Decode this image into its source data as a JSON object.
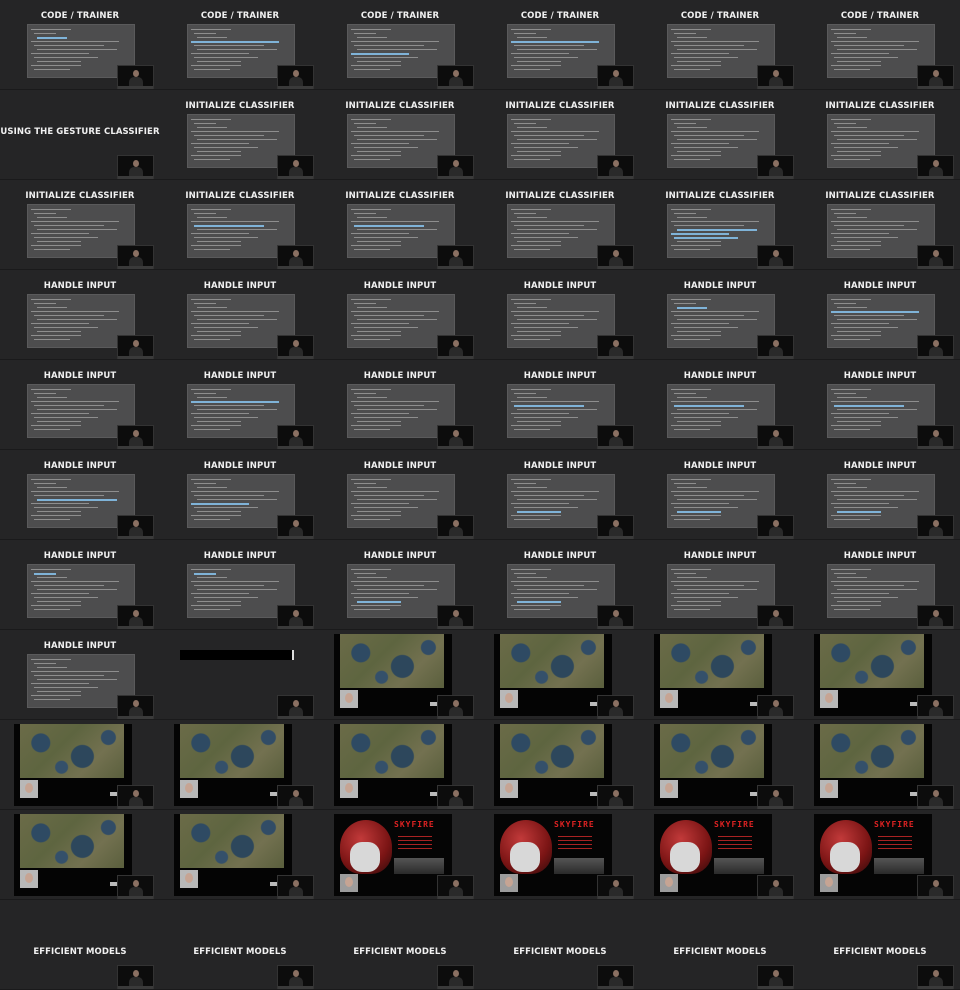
{
  "cells": [
    {
      "title": "CODE / TRAINER",
      "kind": "code",
      "hl": [
        2
      ]
    },
    {
      "title": "CODE / TRAINER",
      "kind": "code",
      "hl": [
        3
      ]
    },
    {
      "title": "CODE / TRAINER",
      "kind": "code",
      "hl": [
        6
      ]
    },
    {
      "title": "CODE / TRAINER",
      "kind": "code",
      "hl": [
        3
      ]
    },
    {
      "title": "CODE / TRAINER",
      "kind": "code",
      "hl": []
    },
    {
      "title": "CODE / TRAINER",
      "kind": "code",
      "hl": []
    },
    {
      "title": "USING THE GESTURE CLASSIFIER",
      "kind": "title-only",
      "hl": []
    },
    {
      "title": "INITIALIZE CLASSIFIER",
      "kind": "code",
      "hl": []
    },
    {
      "title": "INITIALIZE CLASSIFIER",
      "kind": "code",
      "hl": []
    },
    {
      "title": "INITIALIZE CLASSIFIER",
      "kind": "code",
      "hl": []
    },
    {
      "title": "INITIALIZE CLASSIFIER",
      "kind": "code",
      "hl": []
    },
    {
      "title": "INITIALIZE CLASSIFIER",
      "kind": "code",
      "hl": []
    },
    {
      "title": "INITIALIZE CLASSIFIER",
      "kind": "code",
      "hl": []
    },
    {
      "title": "INITIALIZE CLASSIFIER",
      "kind": "code",
      "hl": [
        4
      ]
    },
    {
      "title": "INITIALIZE CLASSIFIER",
      "kind": "code",
      "hl": [
        4
      ]
    },
    {
      "title": "INITIALIZE CLASSIFIER",
      "kind": "code",
      "hl": []
    },
    {
      "title": "INITIALIZE CLASSIFIER",
      "kind": "code",
      "hl": [
        5,
        6,
        7
      ]
    },
    {
      "title": "INITIALIZE CLASSIFIER",
      "kind": "code",
      "hl": []
    },
    {
      "title": "HANDLE INPUT",
      "kind": "code",
      "hl": []
    },
    {
      "title": "HANDLE INPUT",
      "kind": "code",
      "hl": []
    },
    {
      "title": "HANDLE INPUT",
      "kind": "code",
      "hl": []
    },
    {
      "title": "HANDLE INPUT",
      "kind": "code",
      "hl": []
    },
    {
      "title": "HANDLE INPUT",
      "kind": "code",
      "hl": [
        2
      ]
    },
    {
      "title": "HANDLE INPUT",
      "kind": "code",
      "hl": [
        3
      ]
    },
    {
      "title": "HANDLE INPUT",
      "kind": "code",
      "hl": []
    },
    {
      "title": "HANDLE INPUT",
      "kind": "code",
      "hl": [
        3
      ]
    },
    {
      "title": "HANDLE INPUT",
      "kind": "code",
      "hl": []
    },
    {
      "title": "HANDLE INPUT",
      "kind": "code",
      "hl": [
        4
      ]
    },
    {
      "title": "HANDLE INPUT",
      "kind": "code",
      "hl": [
        4
      ]
    },
    {
      "title": "HANDLE INPUT",
      "kind": "code",
      "hl": [
        4
      ]
    },
    {
      "title": "HANDLE INPUT",
      "kind": "code",
      "hl": [
        5
      ]
    },
    {
      "title": "HANDLE INPUT",
      "kind": "code",
      "hl": [
        6
      ]
    },
    {
      "title": "HANDLE INPUT",
      "kind": "code",
      "hl": []
    },
    {
      "title": "HANDLE INPUT",
      "kind": "code",
      "hl": [
        8
      ]
    },
    {
      "title": "HANDLE INPUT",
      "kind": "code",
      "hl": [
        8
      ]
    },
    {
      "title": "HANDLE INPUT",
      "kind": "code",
      "hl": [
        8
      ]
    },
    {
      "title": "HANDLE INPUT",
      "kind": "code",
      "hl": [
        1
      ]
    },
    {
      "title": "HANDLE INPUT",
      "kind": "code",
      "hl": [
        1
      ]
    },
    {
      "title": "HANDLE INPUT",
      "kind": "code",
      "hl": [
        8
      ]
    },
    {
      "title": "HANDLE INPUT",
      "kind": "code",
      "hl": [
        8
      ]
    },
    {
      "title": "HANDLE INPUT",
      "kind": "code",
      "hl": []
    },
    {
      "title": "HANDLE INPUT",
      "kind": "code",
      "hl": []
    },
    {
      "title": "HANDLE INPUT",
      "kind": "code",
      "hl": [
        12
      ]
    },
    {
      "title": "",
      "kind": "black-bar",
      "hl": []
    },
    {
      "title": "",
      "kind": "game",
      "hl": []
    },
    {
      "title": "",
      "kind": "game",
      "hl": []
    },
    {
      "title": "",
      "kind": "game",
      "hl": []
    },
    {
      "title": "",
      "kind": "game",
      "hl": []
    },
    {
      "title": "",
      "kind": "game",
      "hl": []
    },
    {
      "title": "",
      "kind": "game",
      "hl": []
    },
    {
      "title": "",
      "kind": "game",
      "hl": []
    },
    {
      "title": "",
      "kind": "game",
      "hl": []
    },
    {
      "title": "",
      "kind": "game",
      "hl": []
    },
    {
      "title": "",
      "kind": "game",
      "hl": []
    },
    {
      "title": "",
      "kind": "game",
      "hl": []
    },
    {
      "title": "",
      "kind": "game",
      "hl": []
    },
    {
      "title": "",
      "kind": "poster",
      "hl": []
    },
    {
      "title": "",
      "kind": "poster",
      "hl": []
    },
    {
      "title": "",
      "kind": "poster",
      "hl": []
    },
    {
      "title": "",
      "kind": "poster",
      "hl": []
    },
    {
      "title": "EFFICIENT MODELS",
      "kind": "title-low",
      "hl": []
    },
    {
      "title": "EFFICIENT MODELS",
      "kind": "title-low",
      "hl": []
    },
    {
      "title": "EFFICIENT MODELS",
      "kind": "title-low",
      "hl": []
    },
    {
      "title": "EFFICIENT MODELS",
      "kind": "title-low",
      "hl": []
    },
    {
      "title": "EFFICIENT MODELS",
      "kind": "title-low",
      "hl": []
    },
    {
      "title": "EFFICIENT MODELS",
      "kind": "title-low",
      "hl": []
    }
  ],
  "poster_title": "SKYFIRE"
}
